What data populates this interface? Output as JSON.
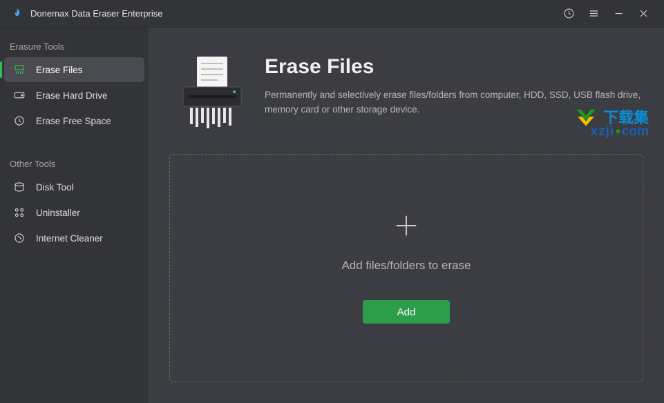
{
  "app_title": "Donemax Data Eraser Enterprise",
  "titlebar_icons": {
    "history": "history-icon",
    "menu": "hamburger-icon",
    "minimize": "minimize-icon",
    "close": "close-icon"
  },
  "sidebar": {
    "sections": [
      {
        "label": "Erasure Tools",
        "items": [
          {
            "id": "erase-files",
            "label": "Erase Files",
            "icon": "shredder-icon",
            "active": true
          },
          {
            "id": "erase-hard-drive",
            "label": "Erase Hard Drive",
            "icon": "hdd-icon",
            "active": false
          },
          {
            "id": "erase-free-space",
            "label": "Erase Free Space",
            "icon": "clock-icon",
            "active": false
          }
        ]
      },
      {
        "label": "Other Tools",
        "items": [
          {
            "id": "disk-tool",
            "label": "Disk Tool",
            "icon": "disk-icon",
            "active": false
          },
          {
            "id": "uninstaller",
            "label": "Uninstaller",
            "icon": "apps-icon",
            "active": false
          },
          {
            "id": "internet-cleaner",
            "label": "Internet Cleaner",
            "icon": "sweep-icon",
            "active": false
          }
        ]
      }
    ]
  },
  "main": {
    "title": "Erase Files",
    "description": "Permanently and selectively erase files/folders from computer, HDD, SSD, USB flash drive, memory card or other storage device.",
    "dropzone_label": "Add files/folders to erase",
    "add_button_label": "Add"
  },
  "watermark": {
    "text_cn": "下载集",
    "site_prefix": "xzji",
    "site_suffix": "com"
  },
  "colors": {
    "accent_green": "#2c9e4b",
    "active_pill": "#4a4b50",
    "bg_sidebar": "#333438",
    "bg_content": "#3c3d42"
  }
}
